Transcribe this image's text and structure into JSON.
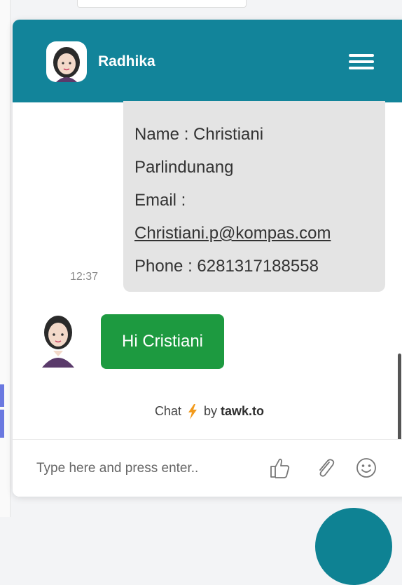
{
  "header": {
    "agent_name": "Radhika",
    "menu_icon": "hamburger-menu-icon",
    "bg_color": "#12849a"
  },
  "messages": {
    "visitor": {
      "line1": "Name : Christiani",
      "line2": "Parlindunang",
      "line3": "Email :",
      "email": "Christiani.p@kompas.com",
      "line5": "Phone : 6281317188558",
      "time": "12:37"
    },
    "agent": {
      "text": "Hi Cristiani",
      "bubble_color": "#1d9a40"
    }
  },
  "branding": {
    "prefix": "Chat",
    "by": "by",
    "brand": "tawk.to",
    "icon": "lightning-bolt-icon"
  },
  "input": {
    "placeholder": "Type here and press enter..",
    "icons": [
      "thumbs-up-icon",
      "paperclip-icon",
      "smiley-icon"
    ]
  }
}
